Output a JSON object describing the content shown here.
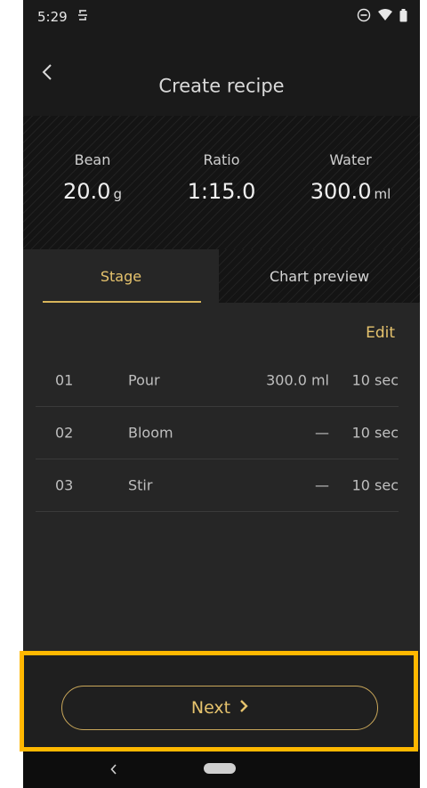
{
  "status_bar": {
    "time": "5:29",
    "icons": [
      "sync-icon",
      "dnd-icon",
      "wifi-icon",
      "battery-icon"
    ]
  },
  "app_bar": {
    "title": "Create recipe",
    "back_icon": "chevron-left-icon"
  },
  "summary": {
    "bean": {
      "label": "Bean",
      "value": "20.0",
      "unit": "g"
    },
    "ratio": {
      "label": "Ratio",
      "value": "1:15.0"
    },
    "water": {
      "label": "Water",
      "value": "300.0",
      "unit": "ml"
    }
  },
  "tabs": [
    {
      "label": "Stage",
      "active": true
    },
    {
      "label": "Chart preview",
      "active": false
    }
  ],
  "edit_label": "Edit",
  "stages": [
    {
      "num": "01",
      "type": "Pour",
      "amount": "300.0 ml",
      "time": "10 sec"
    },
    {
      "num": "02",
      "type": "Bloom",
      "amount": "—",
      "time": "10 sec"
    },
    {
      "num": "03",
      "type": "Stir",
      "amount": "—",
      "time": "10 sec"
    }
  ],
  "next_button": {
    "label": "Next",
    "icon": "chevron-right-icon"
  },
  "colors": {
    "accent": "#e6c36d",
    "background": "#262626",
    "highlight": "#ffb800"
  }
}
